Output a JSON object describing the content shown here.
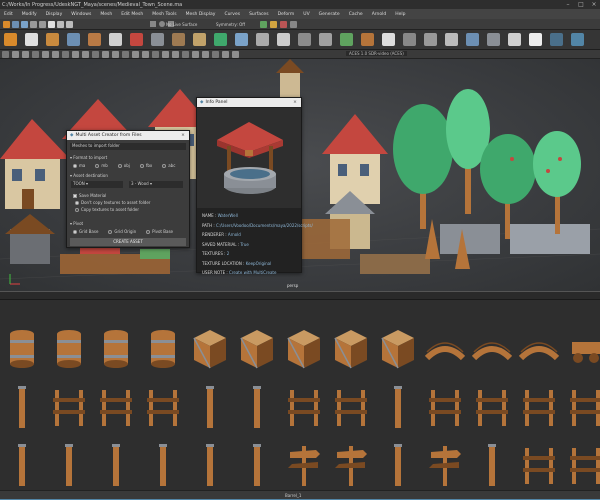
{
  "window": {
    "title": "C:/Works/In Progress/UdeskNGT_Maya/scenes/Medieval_Town_Scene.ma"
  },
  "menubar": {
    "items": [
      "Edit",
      "Modify",
      "Display",
      "Windows",
      "Mesh",
      "Edit Mesh",
      "Mesh Tools",
      "Mesh Display",
      "Curves",
      "Surfaces",
      "Deform",
      "UV",
      "Generate",
      "Cache",
      "Arnold",
      "Help"
    ]
  },
  "statusline": {
    "live_surface": "No Live Surface",
    "symmetry": "Symmetry: Off"
  },
  "viewport_toolbar": {
    "colorspace": "ACES 1.0 SDR-video (ACES)"
  },
  "import_panel": {
    "title": "Multi Asset Creator from Files",
    "section_import": "Meshes to import folder",
    "formats_label": "Format to import",
    "formats": [
      "ma",
      "mb",
      "obj",
      "fbx",
      "abc"
    ],
    "destination_label": "Asset destination",
    "dest_folder": "TOON",
    "dest_sub": "3 - Wood",
    "options": [
      {
        "label": "Save Material",
        "checked": true
      },
      {
        "label": "Don't copy textures to asset folder",
        "checked": true
      },
      {
        "label": "Copy textures to asset folder",
        "checked": false
      }
    ],
    "pivot_label": "Pivot",
    "pivot_options": [
      "Grid Base",
      "Grid Origin",
      "Pivot Base"
    ],
    "create_button": "CREATE ASSET"
  },
  "info_panel": {
    "title": "Info Panel",
    "fields": [
      {
        "key": "NAME",
        "value": "WaterWell"
      },
      {
        "key": "PATH",
        "value": "C:/Users/Voodoo/Documents/maya/2022/scripts/"
      },
      {
        "key": "RENDERER",
        "value": "Arnold"
      },
      {
        "key": "SAVED MATERIAL",
        "value": "True"
      },
      {
        "key": "TEXTURES",
        "value": "2"
      },
      {
        "key": "TEXTURE LOCATION",
        "value": "KeepOriginal"
      },
      {
        "key": "USER NOTE",
        "value": "Create with MultiCreate"
      }
    ]
  },
  "footer": {
    "viewport_label": "persp",
    "shelf_label": "Barrel_1"
  },
  "colors": {
    "accent": "#5285a6",
    "wood": "#b5743a",
    "wood_dark": "#7a4a22",
    "metal": "#8a8f96",
    "roof_red": "#c4473f",
    "leaf": "#3fa86c",
    "leaf_light": "#5bc98b"
  },
  "asset_rows": [
    [
      "barrel-icon",
      "barrel-icon",
      "barrel-icon",
      "barrel-icon",
      "crate-icon",
      "crate-icon",
      "crate-icon",
      "crate-icon",
      "crate-icon",
      "bridge-icon",
      "bridge-icon",
      "bridge-icon",
      "cart-icon"
    ],
    [
      "post-icon",
      "fence-icon",
      "fence-icon",
      "fence-icon",
      "post-icon",
      "post-icon",
      "fence-icon",
      "fence-icon",
      "post-icon",
      "fence-icon",
      "fence-icon",
      "fence-icon",
      "fence-icon"
    ],
    [
      "post-icon",
      "post-icon",
      "post-icon",
      "post-icon",
      "post-icon",
      "post-icon",
      "sign-icon",
      "sign-icon",
      "post-icon",
      "sign-icon",
      "post-icon",
      "fence-icon",
      "fence-icon"
    ]
  ]
}
